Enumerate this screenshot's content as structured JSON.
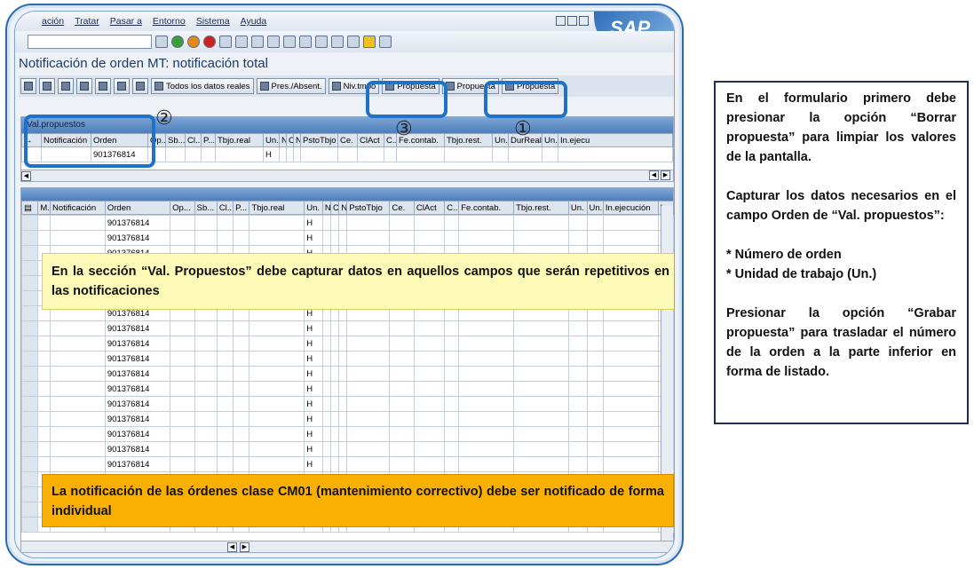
{
  "menu": [
    "ación",
    "Tratar",
    "Pasar a",
    "Entorno",
    "Sistema",
    "Ayuda"
  ],
  "logo": "SAP",
  "page_title": "Notificación de orden MT: notificación total",
  "app_toolbar": {
    "all_real": "Todos los datos reales",
    "pres_absent": "Pres./Absent.",
    "niv_tmpo": "Niv.tmpo",
    "propuesta_1": "Propuesta",
    "propuesta_2": "Propuesta",
    "propuesta_3": "Propuesta"
  },
  "val_propuestos": {
    "header": "Val.propuestos",
    "columns": [
      "Notificación",
      "Orden",
      "Op...",
      "Sb...",
      "Cl...",
      "P...",
      "Tbjo.real",
      "Un.",
      "N",
      "C",
      "N",
      "PstoTbjo",
      "Ce.",
      "ClAct",
      "C...",
      "Fe.contab.",
      "Tbjo.rest.",
      "Un.",
      "DurReal",
      "Un.",
      "In.ejecu"
    ],
    "row": {
      "orden": "901376814",
      "un": "H"
    }
  },
  "list": {
    "columns": [
      "M..",
      "Notificación",
      "Orden",
      "Op...",
      "Sb...",
      "Cl...",
      "P...",
      "Tbjo.real",
      "Un.",
      "N",
      "C",
      "N",
      "PstoTbjo",
      "Ce.",
      "ClAct",
      "C...",
      "Fe.contab.",
      "Tbjo.rest.",
      "Un.",
      "Un.",
      "In.ejecución",
      "In."
    ],
    "order": "901376814",
    "unit": "H",
    "trail": "0("
  },
  "callouts": {
    "yellow": "En la sección “Val. Propuestos” debe capturar datos en aquellos campos que serán repetitivos en las notificaciones",
    "orange": "La notificación de las órdenes clase CM01 (mantenimiento correctivo) debe ser notificado de forma individual"
  },
  "markers": [
    "②",
    "③",
    "①"
  ],
  "side_note": {
    "p1": "En el formulario primero debe presionar la opción “Borrar propuesta” para limpiar los valores de la pantalla.",
    "p2": "Capturar los datos necesarios en el campo Orden de “Val. propuestos”:",
    "p3a": "* Número de orden",
    "p3b": "* Unidad de trabajo (Un.)",
    "p4": "Presionar la opción “Grabar propuesta” para trasladar el número de la orden a la parte inferior en forma de listado."
  },
  "colors": {
    "highlight": "#1e73c8",
    "yellow": "#fdfbb7",
    "orange": "#f9b000",
    "frame": "#2a6bb5"
  }
}
